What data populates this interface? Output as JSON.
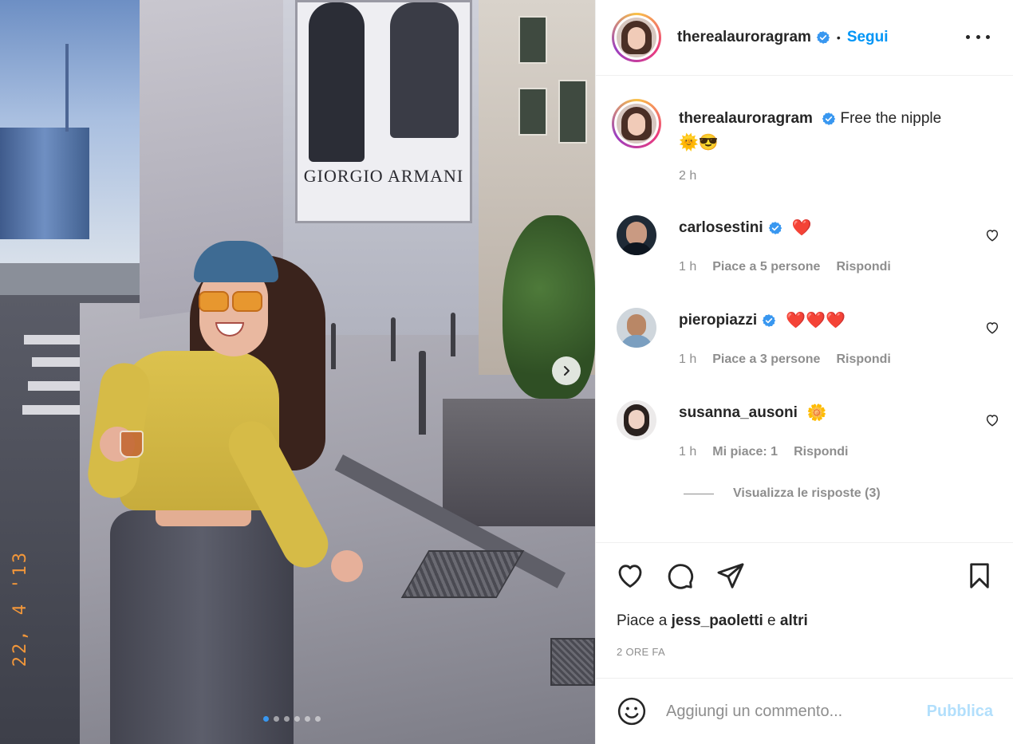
{
  "post": {
    "author": "therealauroragram",
    "follow_label": "Segui",
    "bullet": "•",
    "caption_text": "Free the nipple",
    "caption_emojis": "🌞😎",
    "caption_age": "2 h",
    "photo_timestamp": "22, 4 '13",
    "slides_total": 6,
    "slide_active": 1
  },
  "comments": [
    {
      "user": "carlosestini",
      "verified": true,
      "text": "❤️",
      "age": "1 h",
      "likes": "Piace a 5 persone",
      "reply": "Rispondi"
    },
    {
      "user": "pieropiazzi",
      "verified": true,
      "text": "❤️❤️❤️",
      "age": "1 h",
      "likes": "Piace a 3 persone",
      "reply": "Rispondi"
    },
    {
      "user": "susanna_ausoni",
      "verified": false,
      "text": "🌼",
      "age": "1 h",
      "likes": "Mi piace: 1",
      "reply": "Rispondi"
    }
  ],
  "view_replies": "Visualizza le risposte (3)",
  "likes_bar": {
    "prefix": "Piace a",
    "user": "jess_paoletti",
    "conj": "e",
    "others": "altri"
  },
  "post_age": "2 ORE FA",
  "add_comment": {
    "placeholder": "Aggiungi un commento...",
    "publish_label": "Pubblica"
  },
  "billboard_text": "GIORGIO ARMANI",
  "colors": {
    "accent": "#0095f6",
    "verified": "#3897f0",
    "muted": "#8e8e8e",
    "publish_disabled": "#b2dffc"
  },
  "icons": [
    "verified-badge-icon",
    "more-options-icon",
    "heart-icon",
    "comment-icon",
    "share-icon",
    "bookmark-icon",
    "emoji-icon",
    "chevron-right-icon"
  ]
}
